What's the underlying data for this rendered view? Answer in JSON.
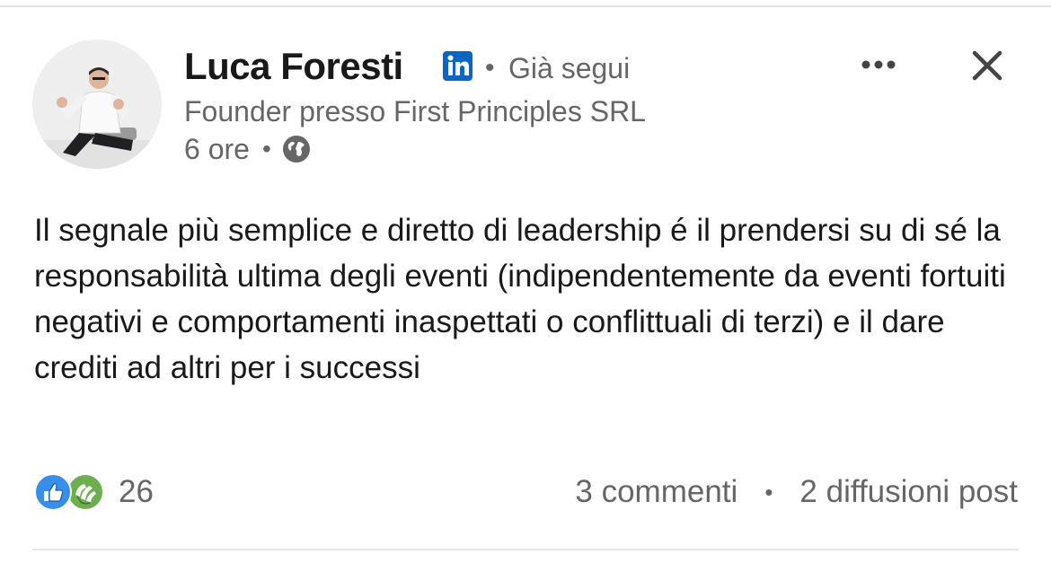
{
  "post": {
    "author": {
      "name": "Luca Foresti",
      "badge_icon": "linkedin-icon",
      "follow_separator": "•",
      "follow_status": "Già segui",
      "headline": "Founder presso First Principles SRL",
      "time": "6 ore",
      "meta_separator": "•",
      "visibility_icon": "globe-icon"
    },
    "actions": {
      "more_icon": "more-horizontal-icon",
      "close_icon": "close-icon"
    },
    "text": "Il segnale più semplice e diretto di leadership é il prendersi su di sé la responsabilità ultima degli eventi (indipendentemente da eventi fortuiti negativi e comportamenti inaspettati o conflittuali di terzi) e il dare crediti ad altri per i successi",
    "social": {
      "reaction_icons": [
        "like-icon",
        "celebrate-icon"
      ],
      "reaction_count": "26",
      "comments": "3 commenti",
      "separator": "•",
      "reposts": "2 diffusioni post"
    }
  },
  "colors": {
    "linkedin_blue": "#0a66c2",
    "celebrate_green": "#44712e",
    "secondary_text": "#666666",
    "primary_text": "#191919"
  }
}
